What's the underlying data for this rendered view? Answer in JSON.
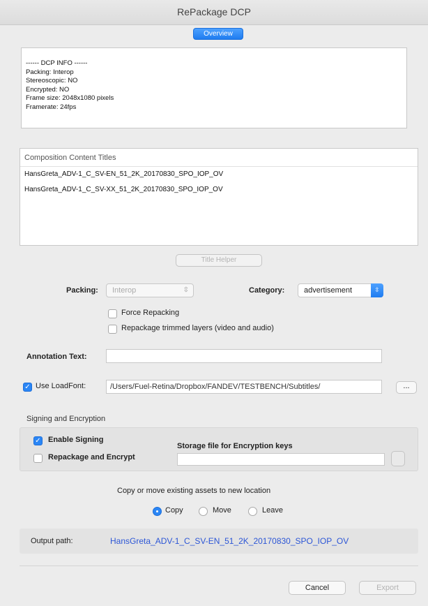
{
  "window": {
    "title": "RePackage DCP"
  },
  "tabs": {
    "overview": "Overview"
  },
  "dcp_info": {
    "lines": [
      "------ DCP INFO ------",
      "Packing: Interop",
      "Stereoscopic: NO",
      "Encrypted: NO",
      "Frame size: 2048x1080 pixels",
      "Framerate: 24fps"
    ]
  },
  "composition": {
    "header": "Composition Content Titles",
    "titles": [
      "HansGreta_ADV-1_C_SV-EN_51_2K_20170830_SPO_IOP_OV",
      "HansGreta_ADV-1_C_SV-XX_51_2K_20170830_SPO_IOP_OV"
    ]
  },
  "title_helper": {
    "label": "Title Helper"
  },
  "packing": {
    "label": "Packing:",
    "value": "Interop"
  },
  "category": {
    "label": "Category:",
    "value": "advertisement"
  },
  "options": {
    "force_repacking": "Force Repacking",
    "repackage_trimmed": "Repackage trimmed layers (video and audio)"
  },
  "annotation": {
    "label": "Annotation Text:",
    "value": ""
  },
  "loadfont": {
    "label": "Use LoadFont:",
    "path": "/Users/Fuel-Retina/Dropbox/FANDEV/TESTBENCH/Subtitles/",
    "browse": "..."
  },
  "signing": {
    "section_title": "Signing and Encryption",
    "enable_signing": "Enable Signing",
    "repackage_encrypt": "Repackage and Encrypt",
    "storage_label": "Storage file for Encryption keys",
    "storage_value": ""
  },
  "assets": {
    "label": "Copy or move existing assets to new location",
    "copy": "Copy",
    "move": "Move",
    "leave": "Leave"
  },
  "output": {
    "label": "Output path:",
    "value": "HansGreta_ADV-1_C_SV-EN_51_2K_20170830_SPO_IOP_OV"
  },
  "buttons": {
    "cancel": "Cancel",
    "export": "Export"
  },
  "colors": {
    "accent": "#2b86f5",
    "output_link": "#2c56d6"
  }
}
